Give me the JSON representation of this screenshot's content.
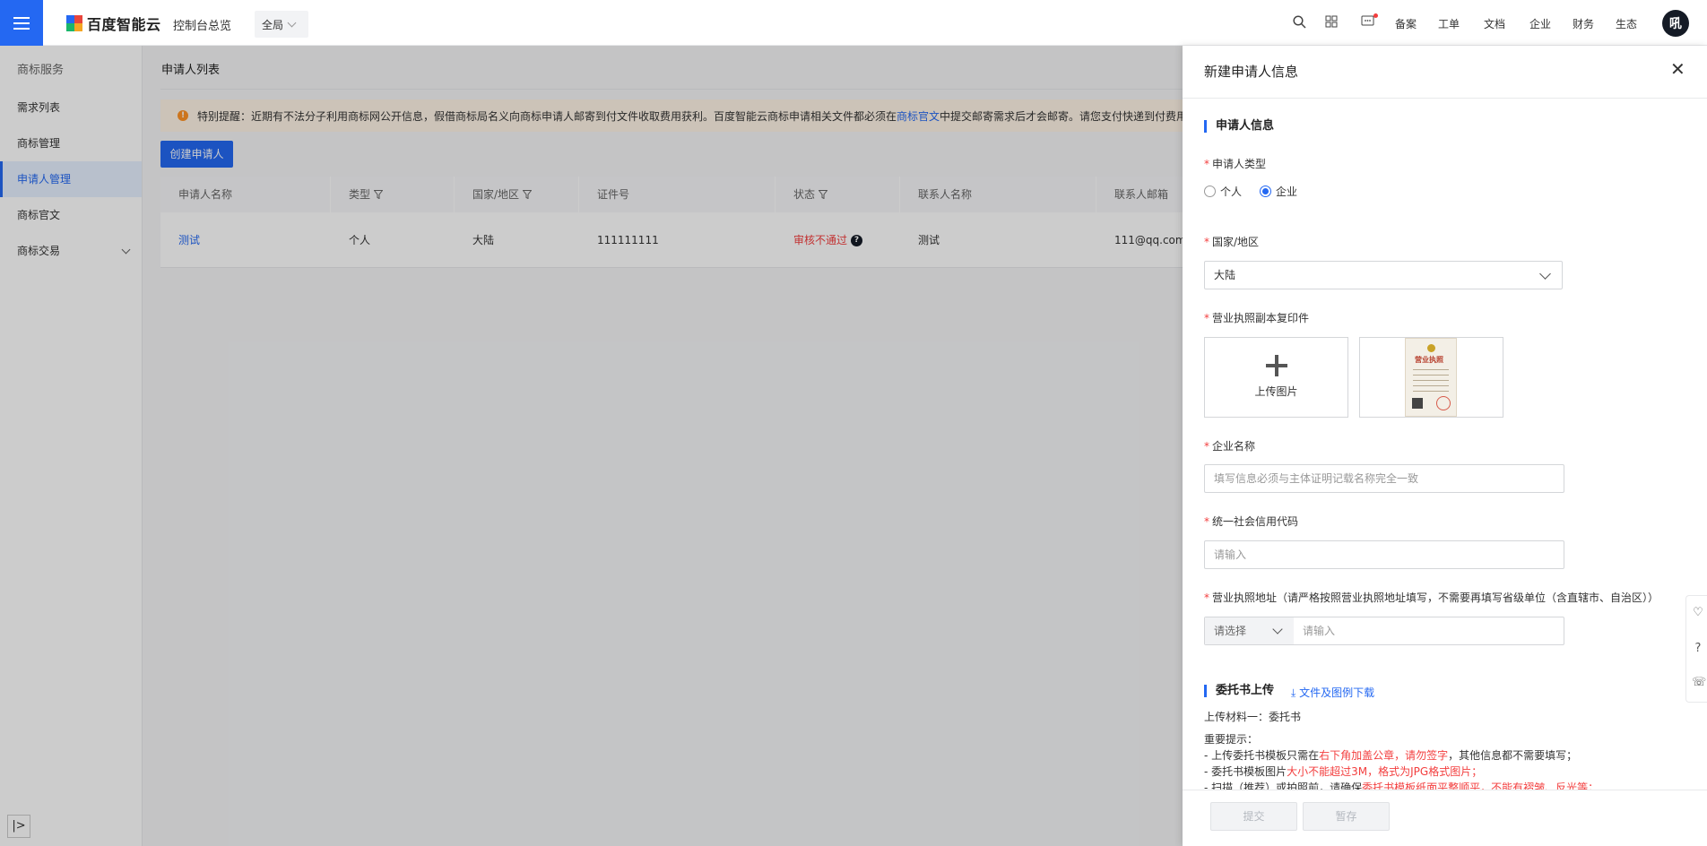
{
  "topbar": {
    "logo_text": "百度智能云",
    "console_link": "控制台总览",
    "region": "全局",
    "links": [
      "备案",
      "工单",
      "文档",
      "企业",
      "财务",
      "生态"
    ],
    "avatar_text": "吼"
  },
  "sidebar": {
    "title": "商标服务",
    "items": [
      {
        "label": "需求列表"
      },
      {
        "label": "商标管理"
      },
      {
        "label": "申请人管理"
      },
      {
        "label": "商标官文"
      },
      {
        "label": "商标交易"
      }
    ]
  },
  "main": {
    "page_title": "申请人列表",
    "notice_prefix": "特别提醒：近期有不法分子利用商标网公开信息，假借商标局名义向商标申请人邮寄到付文件收取费用获利。百度智能云商标申请相关文件都必须在",
    "notice_link": "商标官文",
    "notice_suffix": "中提交邮寄需求后才会邮寄。请您支付快递到付费用",
    "create_button": "创建申请人",
    "table": {
      "columns": [
        "申请人名称",
        "类型",
        "国家/地区",
        "证件号",
        "状态",
        "联系人名称",
        "联系人邮箱"
      ],
      "rows": [
        {
          "name": "测试",
          "type": "个人",
          "region": "大陆",
          "id_no": "111111111",
          "status": "审核不通过",
          "contact": "测试",
          "email": "111@qq.com"
        }
      ]
    }
  },
  "drawer": {
    "title": "新建申请人信息",
    "section_applicant": "申请人信息",
    "applicant_type_label": "申请人类型",
    "radio_person": "个人",
    "radio_company": "企业",
    "selected_type": "企业",
    "region_label": "国家/地区",
    "region_value": "大陆",
    "license_label": "营业执照副本复印件",
    "upload_text": "上传图片",
    "license_image_title": "营业执照",
    "company_name_label": "企业名称",
    "company_name_placeholder": "填写信息必须与主体证明记载名称完全一致",
    "credit_code_label": "统一社会信用代码",
    "credit_code_placeholder": "请输入",
    "address_label": "营业执照地址（请严格按照营业执照地址填写，不需要再填写省级单位（含直辖市、自治区））",
    "address_select_placeholder": "请选择",
    "address_input_placeholder": "请输入",
    "section_proxy": "委托书上传",
    "download_link": "文件及图例下载",
    "material_line": "上传材料一：委托书",
    "tips_title": "重要提示：",
    "tip1_a": "- 上传委托书模板只需在",
    "tip1_b": "右下角加盖公章，请勿签字",
    "tip1_c": "，其他信息都不需要填写；",
    "tip2_a": "- 委托书模板图片",
    "tip2_b": "大小不能超过3M，格式为JPG格式图片；",
    "tip3_a": "- 扫描（推荐）或拍照前，请确保",
    "tip3_b": "委托书模板纸面平整顺平，不能有褶皱、反光等；",
    "submit_button": "提交",
    "save_button": "暂存"
  },
  "colors": {
    "accent": "#2468f2",
    "danger": "#f33e3e",
    "warning_bg": "#fff4e6"
  }
}
